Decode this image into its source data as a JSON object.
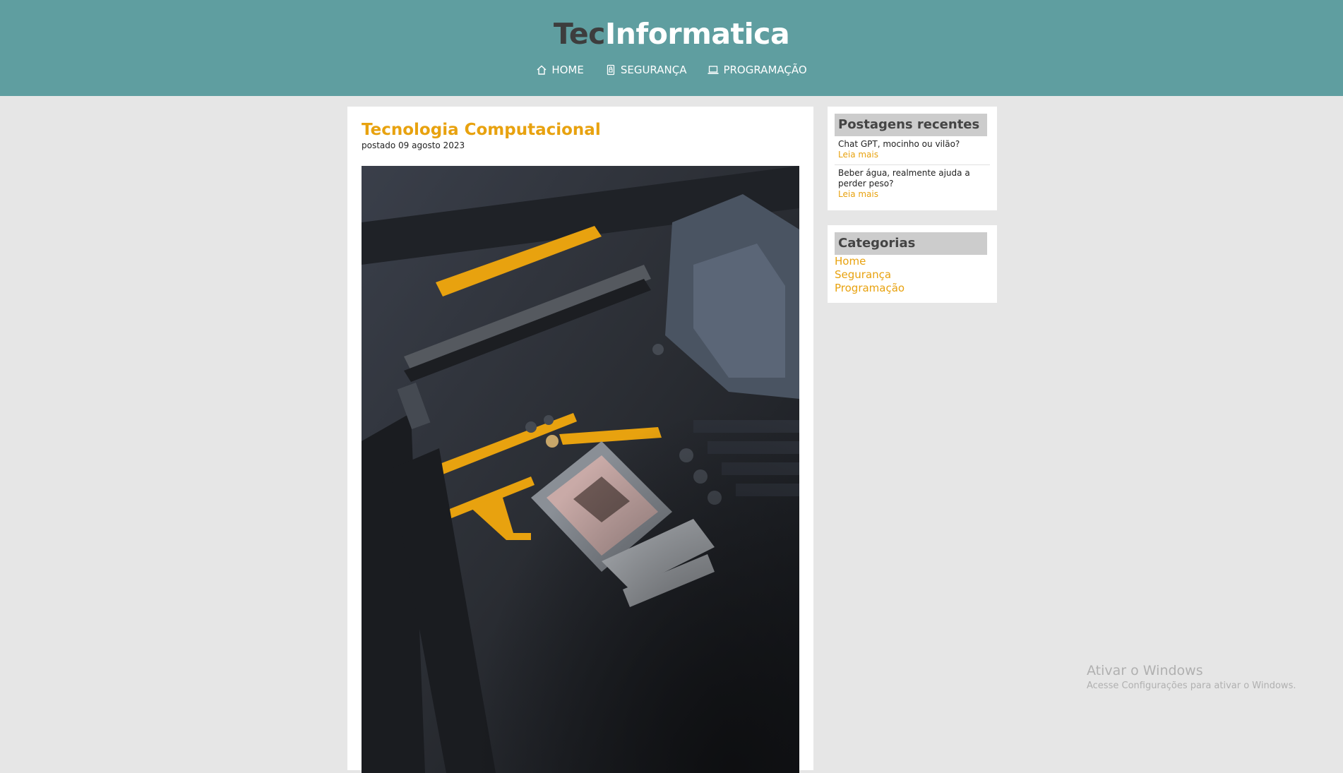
{
  "header": {
    "brand_part1": "Tec",
    "brand_part2": "Informatica",
    "nav": [
      {
        "label": "HOME",
        "icon": "home-icon"
      },
      {
        "label": "SEGURANÇA",
        "icon": "lock-icon"
      },
      {
        "label": "PROGRAMAÇÃO",
        "icon": "laptop-icon"
      }
    ]
  },
  "post": {
    "title": "Tecnologia Computacional",
    "date": "postado 09 agosto 2023",
    "image": "motherboard-photo"
  },
  "sidebar": {
    "recent": {
      "title": "Postagens recentes",
      "items": [
        {
          "title": "Chat GPT, mocinho ou vilão?",
          "more": "Leia mais"
        },
        {
          "title": "Beber água, realmente ajuda a perder peso?",
          "more": "Leia mais"
        }
      ]
    },
    "categories": {
      "title": "Categorias",
      "items": [
        "Home",
        "Segurança",
        "Programação"
      ]
    }
  },
  "watermark": {
    "line1": "Ativar o Windows",
    "line2": "Acesse Configurações para ativar o Windows."
  },
  "colors": {
    "header_bg": "#5f9ea0",
    "accent": "#e8a20f",
    "page_bg": "#e6e6e6"
  }
}
